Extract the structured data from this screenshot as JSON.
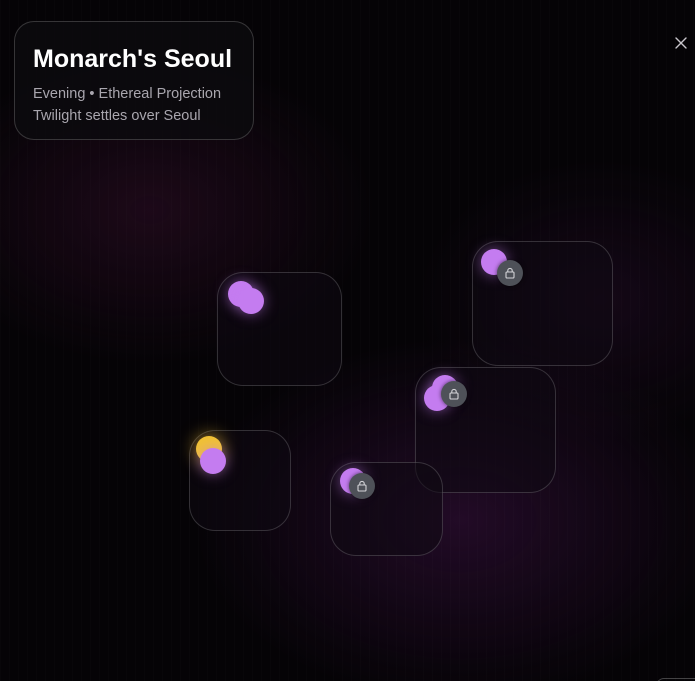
{
  "header": {
    "title": "Monarch's Seoul",
    "subtitle": "Evening • Ethereal Projection",
    "description": "Twilight settles over Seoul"
  },
  "close_button": {
    "icon": "close-icon"
  },
  "colors": {
    "background": "#050306",
    "node_purple": "#c47cf0",
    "node_gold": "#f1c232",
    "lock_badge": "#4e5158"
  },
  "map": {
    "zones": [
      {
        "id": "zone-a",
        "locked": false,
        "nodes": [
          "purple",
          "purple"
        ]
      },
      {
        "id": "zone-b",
        "locked": true,
        "nodes": [
          "purple"
        ]
      },
      {
        "id": "zone-c",
        "locked": true,
        "nodes": [
          "purple",
          "purple"
        ]
      },
      {
        "id": "zone-d",
        "locked": false,
        "nodes": [
          "gold",
          "purple"
        ],
        "current": true
      },
      {
        "id": "zone-e",
        "locked": true,
        "nodes": [
          "purple"
        ]
      }
    ]
  }
}
